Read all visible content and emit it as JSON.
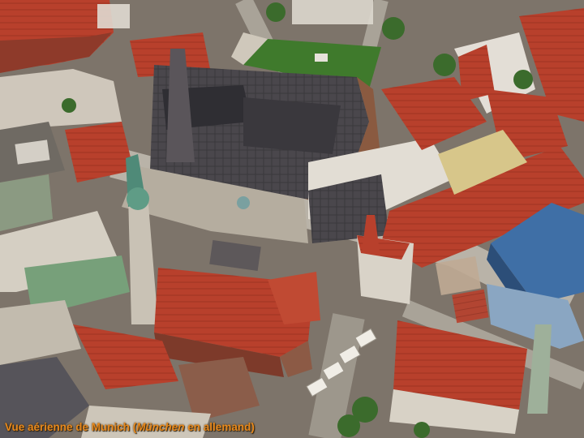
{
  "caption": {
    "prefix": "Vue aérienne de Munich (",
    "italic": "München",
    "suffix": " en allemand)"
  },
  "colors": {
    "roof_red": "#b8402c",
    "roof_dark": "#3e3c40",
    "lawn": "#3f7a2c",
    "roof_blue": "#3f6fa6",
    "caption": "#e8891d"
  }
}
